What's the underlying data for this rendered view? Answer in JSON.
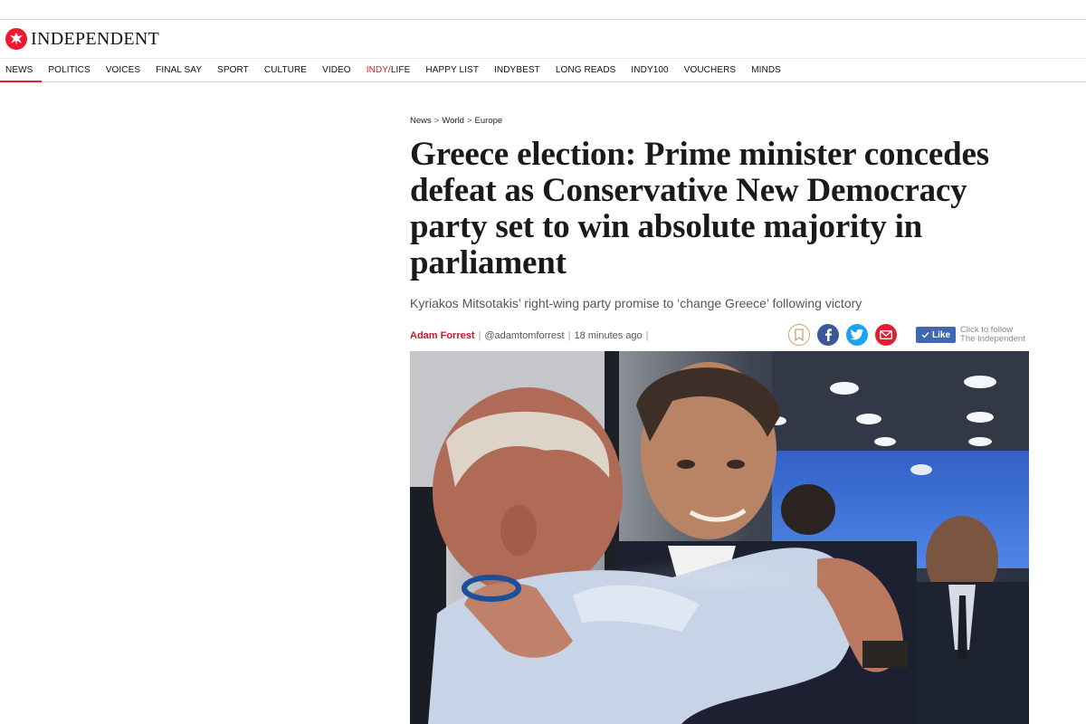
{
  "site": {
    "name": "INDEPENDENT",
    "accent": "#ec1a2e"
  },
  "nav": {
    "items": [
      {
        "label": "NEWS"
      },
      {
        "label": "POLITICS"
      },
      {
        "label": "VOICES"
      },
      {
        "label": "FINAL SAY"
      },
      {
        "label": "SPORT"
      },
      {
        "label": "CULTURE"
      },
      {
        "label": "VIDEO"
      },
      {
        "label_a": "INDY",
        "label_sep": "/",
        "label_b": "LIFE"
      },
      {
        "label": "HAPPY LIST"
      },
      {
        "label": "INDYBEST"
      },
      {
        "label": "LONG READS"
      },
      {
        "label": "INDY100"
      },
      {
        "label": "VOUCHERS"
      },
      {
        "label": "MINDS"
      }
    ],
    "active": "NEWS"
  },
  "breadcrumb": {
    "items": [
      "News",
      "World",
      "Europe"
    ],
    "separator": ">"
  },
  "article": {
    "headline": "Greece election: Prime minister concedes defeat as Conservative New Democracy party set to win absolute majority in parliament",
    "standfirst": "Kyriakos Mitsotakis’ right-wing party promise to ‘change Greece’ following victory",
    "author": "Adam Forrest",
    "handle": "@adamtomforrest",
    "time": "18 minutes ago"
  },
  "share": {
    "icons": [
      "bookmark-icon",
      "facebook-icon",
      "twitter-icon",
      "email-icon"
    ],
    "colors": {
      "facebook": "#3b5998",
      "twitter": "#1da1f2",
      "email": "#e02031"
    }
  },
  "like": {
    "label": "Like",
    "caption_line1": "Click to follow",
    "caption_line2": "The Independent"
  },
  "hero": {
    "description_icon": "photo"
  }
}
